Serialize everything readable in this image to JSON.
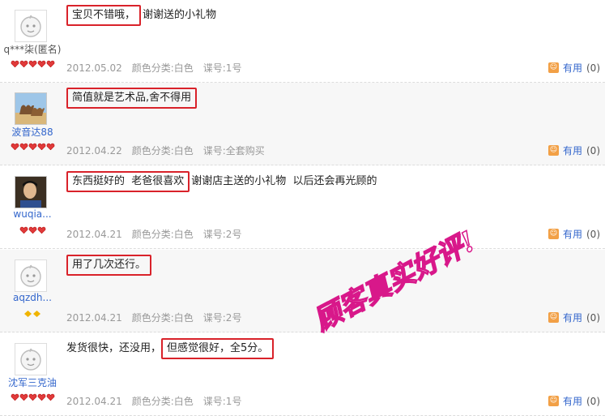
{
  "reviews": [
    {
      "username": "q***柒(匿名)",
      "avatar": "default-avatar-icon",
      "rank_icon": "red-heart-icon",
      "rank_count": 5,
      "highlighted": "宝贝不错哦，",
      "text_before": "",
      "text_after": "谢谢送的小礼物",
      "date": "2012.05.02",
      "color": "颜色分类:白色",
      "size": "谍号:1号",
      "useful_label": "有用",
      "useful_count": "(0)"
    },
    {
      "username": "波音达88",
      "avatar": "camel-photo-avatar",
      "rank_icon": "red-heart-icon",
      "rank_count": 5,
      "highlighted": "简值就是艺术品,舍不得用",
      "text_before": "",
      "text_after": "",
      "date": "2012.04.22",
      "color": "颜色分类:白色",
      "size": "谍号:全套购买",
      "useful_label": "有用",
      "useful_count": "(0)"
    },
    {
      "username": "wuqia...",
      "avatar": "person-photo-avatar",
      "rank_icon": "red-heart-icon",
      "rank_count": 3,
      "highlighted": "东西挺好的  老爸很喜欢",
      "text_before": "",
      "text_after": "谢谢店主送的小礼物  以后还会再光顾的",
      "date": "2012.04.21",
      "color": "颜色分类:白色",
      "size": "谍号:2号",
      "useful_label": "有用",
      "useful_count": "(0)"
    },
    {
      "username": "aqzdh...",
      "avatar": "default-avatar-icon",
      "rank_icon": "yellow-diamond-icon",
      "rank_count": 2,
      "highlighted": "用了几次还行。",
      "text_before": "",
      "text_after": "",
      "date": "2012.04.21",
      "color": "颜色分类:白色",
      "size": "谍号:2号",
      "useful_label": "有用",
      "useful_count": "(0)"
    },
    {
      "username": "沈军三克油",
      "avatar": "default-avatar-icon",
      "rank_icon": "red-heart-icon",
      "rank_count": 5,
      "highlighted": "但感觉很好，全5分。",
      "text_before": "发货很快，还没用，",
      "text_after": "",
      "date": "2012.04.21",
      "color": "颜色分类:白色",
      "size": "谍号:1号",
      "useful_label": "有用",
      "useful_count": "(0)"
    }
  ],
  "stamp": {
    "text": "顾客真实好评!",
    "color": "#d8188a"
  },
  "colors": {
    "highlight_border": "#d9222a",
    "link": "#3366cc",
    "meta": "#999999",
    "heart": "#e03a3a",
    "diamond": "#f0b400"
  }
}
